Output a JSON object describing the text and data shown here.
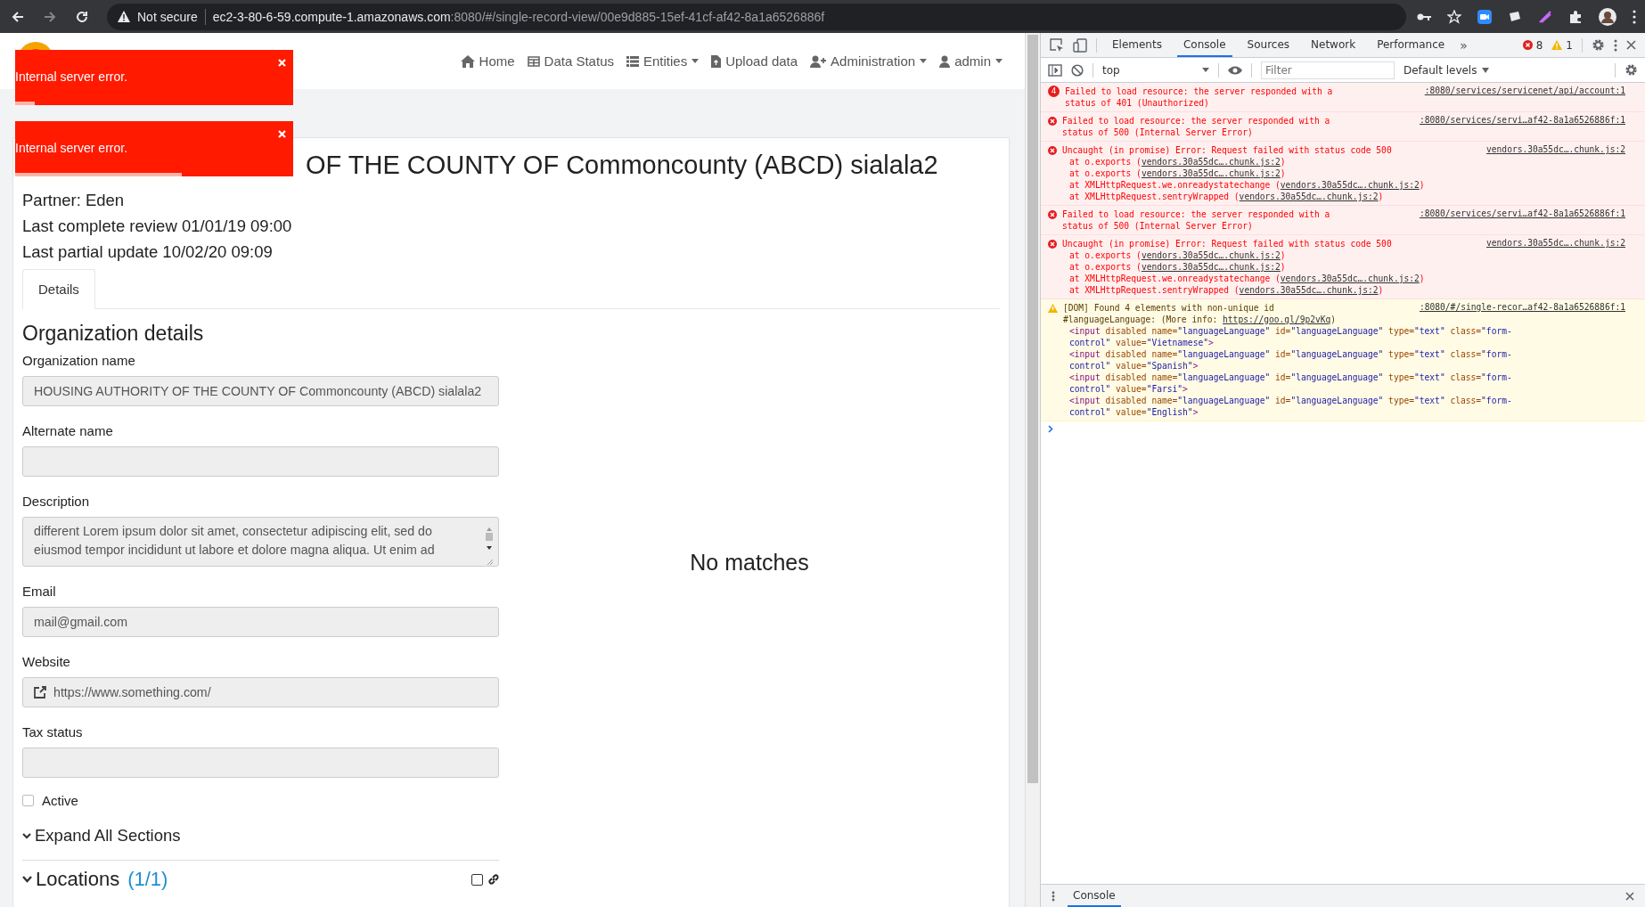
{
  "browser": {
    "security": "Not secure",
    "url_host": "ec2-3-80-6-59.compute-1.amazonaws.com",
    "url_rest": ":8080/#/single-record-view/00e9d885-15ef-41cf-af42-8a1a6526886f"
  },
  "navbar": {
    "items": [
      {
        "label": "Home",
        "dropdown": false
      },
      {
        "label": "Data Status",
        "dropdown": false
      },
      {
        "label": "Entities",
        "dropdown": true
      },
      {
        "label": "Upload data",
        "dropdown": false
      },
      {
        "label": "Administration",
        "dropdown": true
      },
      {
        "label": "admin",
        "dropdown": true
      }
    ]
  },
  "toasts": [
    {
      "message": "Internal server error.",
      "level": 0.07
    },
    {
      "message": "Internal server error.",
      "level": 0.6
    }
  ],
  "record": {
    "title": "OF THE COUNTY OF Commoncounty (ABCD) sialala2",
    "meta": [
      "Partner: Eden",
      "Last complete review 01/01/19 09:00",
      "Last partial update 10/02/20 09:09"
    ],
    "tabs": [
      {
        "label": "Details",
        "selected": true
      }
    ],
    "section_title": "Organization details",
    "fields": [
      {
        "label": "Organization name",
        "kind": "input",
        "value": "HOUSING AUTHORITY OF THE COUNTY OF Commoncounty (ABCD) sialala2"
      },
      {
        "label": "Alternate name",
        "kind": "input"
      },
      {
        "label": "Description",
        "kind": "textarea",
        "value": "different Lorem ipsum dolor sit amet, consectetur adipiscing elit, sed do eiusmod tempor incididunt ut labore et dolore magna aliqua. Ut enim ad"
      },
      {
        "label": "Email",
        "kind": "input",
        "value": "mail@gmail.com"
      },
      {
        "label": "Website",
        "kind": "link",
        "value": "https://www.something.com/"
      },
      {
        "label": "Tax status",
        "kind": "input"
      }
    ],
    "active": {
      "label": "Active",
      "checked": false
    },
    "expand_all": "Expand All Sections",
    "locations": {
      "title": "Locations",
      "count": "(1/1)",
      "checked": false
    },
    "empty_message": "No matches"
  },
  "devtools": {
    "tabs": [
      {
        "label": "Elements",
        "selected": false
      },
      {
        "label": "Console",
        "selected": true
      },
      {
        "label": "Sources",
        "selected": false
      },
      {
        "label": "Network",
        "selected": false
      },
      {
        "label": "Performance",
        "selected": false
      }
    ],
    "more": "»",
    "error_count": "8",
    "warning_count": "1",
    "context": "top",
    "filter_placeholder": "Filter",
    "levels": "Default levels",
    "messages": [
      {
        "kind": "error",
        "badge": "4",
        "lines": [
          "Failed to load resource: the server responded with a",
          "status of 401 (Unauthorized)"
        ],
        "source": ":8080/services/servicenet/api/account:1"
      },
      {
        "kind": "error",
        "lines": [
          "Failed to load resource: the server responded with a",
          "status of 500 (Internal Server Error)"
        ],
        "source": ":8080/services/servi…af42-8a1a6526886f:1"
      },
      {
        "kind": "error",
        "lines": [
          "Uncaught (in promise) Error: Request failed with status code 500"
        ],
        "source": "vendors.30a55dc….chunk.js:2",
        "stack": [
          {
            "prefix": "at o.exports (",
            "link": "vendors.30a55dc….chunk.js:2",
            "suffix": ")"
          },
          {
            "prefix": "at o.exports (",
            "link": "vendors.30a55dc….chunk.js:2",
            "suffix": ")"
          },
          {
            "prefix": "at XMLHttpRequest.we.onreadystatechange (",
            "link": "vendors.30a55dc….chunk.js:2",
            "suffix": ")"
          },
          {
            "prefix": "at XMLHttpRequest.sentryWrapped (",
            "link": "vendors.30a55dc….chunk.js:2",
            "suffix": ")"
          }
        ]
      },
      {
        "kind": "error",
        "lines": [
          "Failed to load resource: the server responded with a",
          "status of 500 (Internal Server Error)"
        ],
        "source": ":8080/services/servi…af42-8a1a6526886f:1"
      },
      {
        "kind": "error",
        "lines": [
          "Uncaught (in promise) Error: Request failed with status code 500"
        ],
        "source": "vendors.30a55dc….chunk.js:2",
        "stack": [
          {
            "prefix": "at o.exports (",
            "link": "vendors.30a55dc….chunk.js:2",
            "suffix": ")"
          },
          {
            "prefix": "at o.exports (",
            "link": "vendors.30a55dc….chunk.js:2",
            "suffix": ")"
          },
          {
            "prefix": "at XMLHttpRequest.we.onreadystatechange (",
            "link": "vendors.30a55dc….chunk.js:2",
            "suffix": ")"
          },
          {
            "prefix": "at XMLHttpRequest.sentryWrapped (",
            "link": "vendors.30a55dc….chunk.js:2",
            "suffix": ")"
          }
        ]
      },
      {
        "kind": "warning",
        "lines": [
          "[DOM] Found 4 elements with non-unique id"
        ],
        "source": ":8080/#/single-recor…af42-8a1a6526886f:1",
        "info": {
          "prefix": "#languageLanguage: (More info: ",
          "link": "https://goo.gl/9p2vKq",
          "suffix": ")"
        },
        "code": [
          [
            {
              "t": "<input",
              "kind": "tag"
            },
            {
              "t": " disabled",
              "kind": "attr"
            },
            {
              "t": " name=",
              "kind": "attr"
            },
            {
              "t": "\"languageLanguage\"",
              "kind": "val"
            },
            {
              "t": " id=",
              "kind": "attr"
            },
            {
              "t": "\"languageLanguage\"",
              "kind": "val"
            },
            {
              "t": " type=",
              "kind": "attr"
            },
            {
              "t": "\"text\"",
              "kind": "val"
            },
            {
              "t": " class=",
              "kind": "attr"
            },
            {
              "t": "\"form-",
              "kind": "val"
            }
          ],
          [
            {
              "t": "control\"",
              "kind": "val"
            },
            {
              "t": " value=",
              "kind": "attr"
            },
            {
              "t": "\"Vietnamese\"",
              "kind": "val"
            },
            {
              "t": ">",
              "kind": "tag"
            }
          ],
          [
            {
              "t": "<input",
              "kind": "tag"
            },
            {
              "t": " disabled",
              "kind": "attr"
            },
            {
              "t": " name=",
              "kind": "attr"
            },
            {
              "t": "\"languageLanguage\"",
              "kind": "val"
            },
            {
              "t": " id=",
              "kind": "attr"
            },
            {
              "t": "\"languageLanguage\"",
              "kind": "val"
            },
            {
              "t": " type=",
              "kind": "attr"
            },
            {
              "t": "\"text\"",
              "kind": "val"
            },
            {
              "t": " class=",
              "kind": "attr"
            },
            {
              "t": "\"form-",
              "kind": "val"
            }
          ],
          [
            {
              "t": "control\"",
              "kind": "val"
            },
            {
              "t": " value=",
              "kind": "attr"
            },
            {
              "t": "\"Spanish\"",
              "kind": "val"
            },
            {
              "t": ">",
              "kind": "tag"
            }
          ],
          [
            {
              "t": "<input",
              "kind": "tag"
            },
            {
              "t": " disabled",
              "kind": "attr"
            },
            {
              "t": " name=",
              "kind": "attr"
            },
            {
              "t": "\"languageLanguage\"",
              "kind": "val"
            },
            {
              "t": " id=",
              "kind": "attr"
            },
            {
              "t": "\"languageLanguage\"",
              "kind": "val"
            },
            {
              "t": " type=",
              "kind": "attr"
            },
            {
              "t": "\"text\"",
              "kind": "val"
            },
            {
              "t": " class=",
              "kind": "attr"
            },
            {
              "t": "\"form-",
              "kind": "val"
            }
          ],
          [
            {
              "t": "control\"",
              "kind": "val"
            },
            {
              "t": " value=",
              "kind": "attr"
            },
            {
              "t": "\"Farsi\"",
              "kind": "val"
            },
            {
              "t": ">",
              "kind": "tag"
            }
          ],
          [
            {
              "t": "<input",
              "kind": "tag"
            },
            {
              "t": " disabled",
              "kind": "attr"
            },
            {
              "t": " name=",
              "kind": "attr"
            },
            {
              "t": "\"languageLanguage\"",
              "kind": "val"
            },
            {
              "t": " id=",
              "kind": "attr"
            },
            {
              "t": "\"languageLanguage\"",
              "kind": "val"
            },
            {
              "t": " type=",
              "kind": "attr"
            },
            {
              "t": "\"text\"",
              "kind": "val"
            },
            {
              "t": " class=",
              "kind": "attr"
            },
            {
              "t": "\"form-",
              "kind": "val"
            }
          ],
          [
            {
              "t": "control\"",
              "kind": "val"
            },
            {
              "t": " value=",
              "kind": "attr"
            },
            {
              "t": "\"English\"",
              "kind": "val"
            },
            {
              "t": ">",
              "kind": "tag"
            }
          ]
        ]
      }
    ],
    "drawer_tab": "Console"
  }
}
